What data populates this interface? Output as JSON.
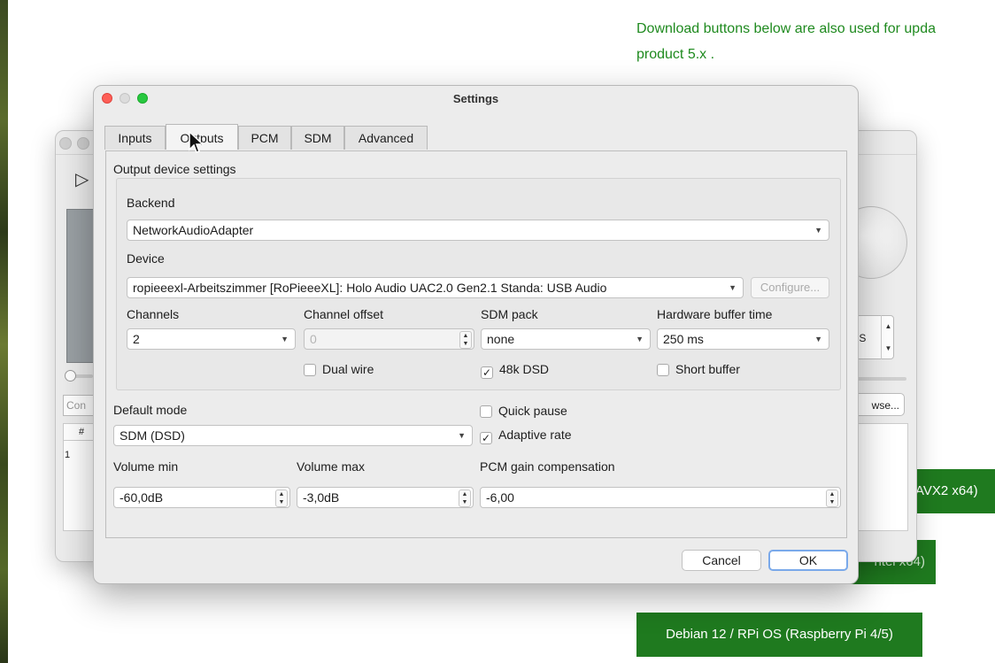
{
  "website": {
    "text_line1": "Download buttons below are also used for upda",
    "text_line2": "product 5.x .",
    "btn_avx": "AVX2 x64)",
    "btn_intel": "ntel x64)",
    "btn_debian": "Debian 12 / RPi OS (Raspberry Pi 4/5)"
  },
  "background_window": {
    "left_input": "Con",
    "table_header": "#",
    "table_row": "1",
    "spin_value": "FS",
    "browse_label": "wse..."
  },
  "dialog": {
    "title": "Settings",
    "tabs": [
      {
        "label": "Inputs"
      },
      {
        "label": "Outputs"
      },
      {
        "label": "PCM"
      },
      {
        "label": "SDM"
      },
      {
        "label": "Advanced"
      }
    ],
    "active_tab": "Outputs",
    "group_title": "Output device settings",
    "backend": {
      "label": "Backend",
      "value": "NetworkAudioAdapter"
    },
    "device": {
      "label": "Device",
      "value": "ropieeexl-Arbeitszimmer [RoPieeeXL]: Holo Audio UAC2.0 Gen2.1 Standa: USB Audio",
      "configure_label": "Configure..."
    },
    "channels": {
      "label": "Channels",
      "value": "2"
    },
    "channel_offset": {
      "label": "Channel offset",
      "value": "0"
    },
    "sdm_pack": {
      "label": "SDM pack",
      "value": "none"
    },
    "hw_buffer": {
      "label": "Hardware buffer time",
      "value": "250 ms"
    },
    "dual_wire": {
      "label": "Dual wire",
      "checked": false
    },
    "dsd48k": {
      "label": "48k DSD",
      "checked": true
    },
    "short_buffer": {
      "label": "Short buffer",
      "checked": false
    },
    "default_mode": {
      "label": "Default mode",
      "value": "SDM (DSD)"
    },
    "quick_pause": {
      "label": "Quick pause",
      "checked": false
    },
    "adaptive_rate": {
      "label": "Adaptive rate",
      "checked": true
    },
    "volume_min": {
      "label": "Volume min",
      "value": "-60,0dB"
    },
    "volume_max": {
      "label": "Volume max",
      "value": "-3,0dB"
    },
    "pcm_gain": {
      "label": "PCM gain compensation",
      "value": "-6,00"
    },
    "cancel_label": "Cancel",
    "ok_label": "OK",
    "checkmark": "✓"
  }
}
